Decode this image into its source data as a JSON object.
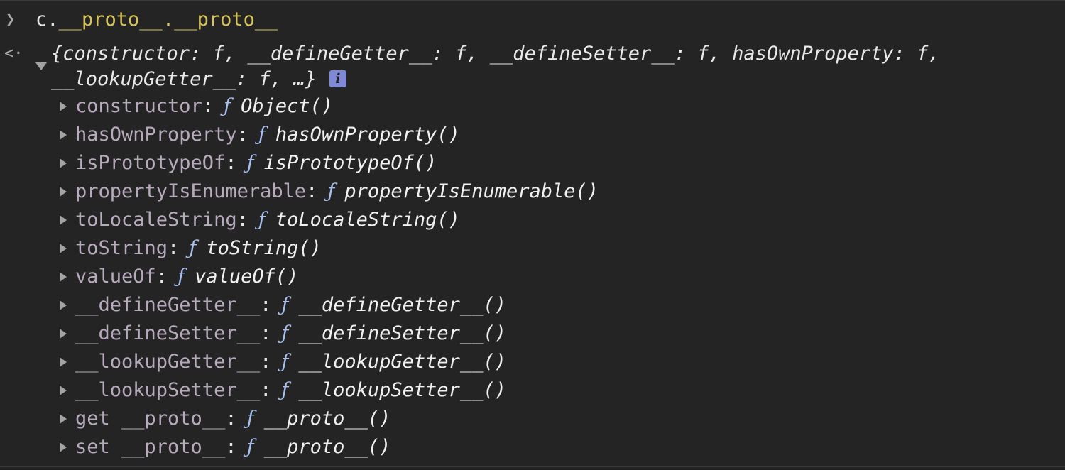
{
  "input": {
    "prompt_icon": "chevron-right-icon",
    "expression_prefix": "c.",
    "expression_rest": "__proto__.__proto__"
  },
  "result": {
    "arrow_icon": "result-arrow-icon",
    "summary_line1": "{constructor: f, __defineGetter__: f, __defineSetter__: f, hasOwnProperty: f,",
    "summary_line2": "__lookupGetter__: f, …}",
    "info_label": "i"
  },
  "properties": [
    {
      "name": "constructor",
      "f": "ƒ",
      "value": "Object()"
    },
    {
      "name": "hasOwnProperty",
      "f": "ƒ",
      "value": "hasOwnProperty()"
    },
    {
      "name": "isPrototypeOf",
      "f": "ƒ",
      "value": "isPrototypeOf()"
    },
    {
      "name": "propertyIsEnumerable",
      "f": "ƒ",
      "value": "propertyIsEnumerable()"
    },
    {
      "name": "toLocaleString",
      "f": "ƒ",
      "value": "toLocaleString()"
    },
    {
      "name": "toString",
      "f": "ƒ",
      "value": "toString()"
    },
    {
      "name": "valueOf",
      "f": "ƒ",
      "value": "valueOf()"
    },
    {
      "name": "__defineGetter__",
      "f": "ƒ",
      "value": "__defineGetter__()"
    },
    {
      "name": "__defineSetter__",
      "f": "ƒ",
      "value": "__defineSetter__()"
    },
    {
      "name": "__lookupGetter__",
      "f": "ƒ",
      "value": "__lookupGetter__()"
    },
    {
      "name": "__lookupSetter__",
      "f": "ƒ",
      "value": "__lookupSetter__()"
    },
    {
      "name": "get __proto__",
      "f": "ƒ",
      "value": "__proto__()"
    },
    {
      "name": "set __proto__",
      "f": "ƒ",
      "value": "__proto__()"
    }
  ],
  "colors": {
    "background": "#242424",
    "expression_accent": "#d6c45a",
    "property_name": "#b8aabd",
    "function_symbol": "#a8c0f0",
    "info_badge": "#7f89d6"
  }
}
